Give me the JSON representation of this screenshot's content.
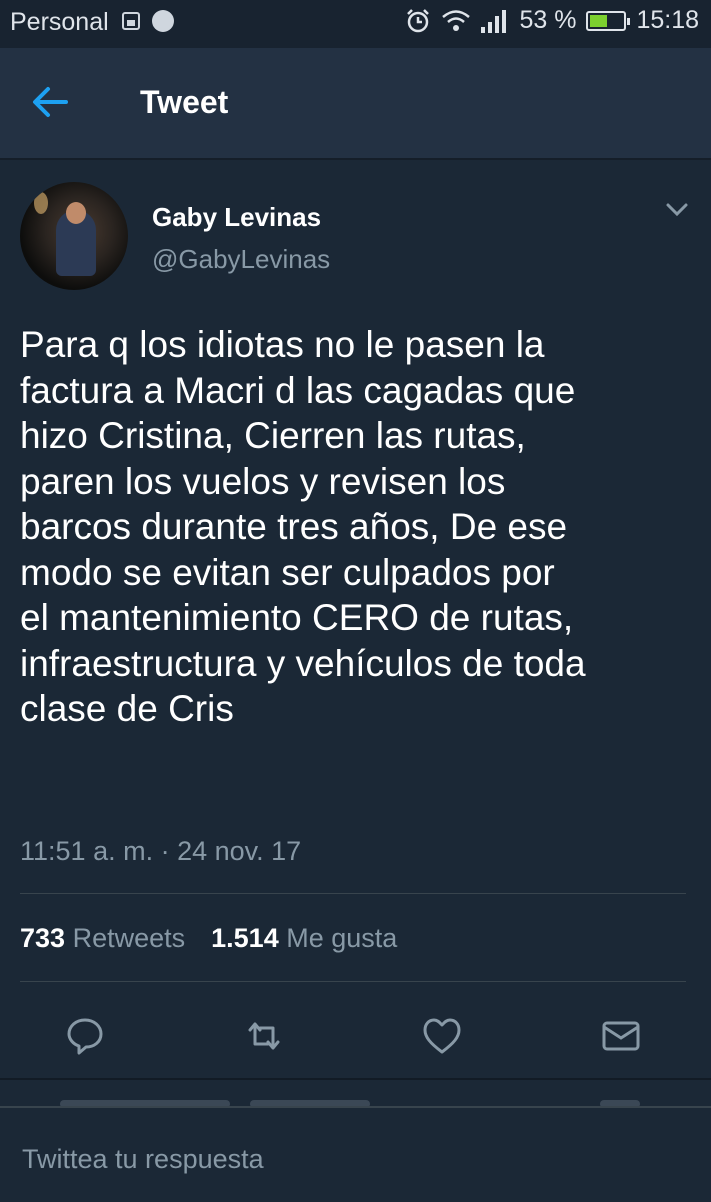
{
  "status_bar": {
    "carrier": "Personal",
    "battery_percent": "53 %",
    "battery_level": 0.53,
    "time": "15:18",
    "icons": [
      "gallery-icon",
      "globe-icon",
      "alarm-icon",
      "wifi-icon",
      "signal-icon",
      "battery-charging-icon"
    ]
  },
  "app_bar": {
    "title": "Tweet",
    "back_icon": "arrow-left-icon"
  },
  "tweet": {
    "author_name": "Gaby Levinas",
    "author_handle": "@GabyLevinas",
    "text": "Para q los idiotas no le pasen la\nfactura a Macri d las cagadas que\nhizo Cristina, Cierren las rutas,\nparen los vuelos y revisen los\nbarcos durante tres años, De ese\nmodo se evitan ser culpados por\nel  mantenimiento CERO de rutas,\ninfraestructura y vehículos de toda\nclase de Cris",
    "timestamp": "11:51 a. m. · 24 nov. 17",
    "retweets_count": "733",
    "retweets_label": "Retweets",
    "likes_count": "1.514",
    "likes_label": "Me gusta"
  },
  "actions": [
    "reply-icon",
    "retweet-icon",
    "like-icon",
    "message-icon"
  ],
  "reply_box": {
    "placeholder": "Twittea tu respuesta"
  },
  "colors": {
    "background": "#1b2836",
    "app_bar": "#233143",
    "accent": "#1da1f2",
    "secondary_text": "#8899a6",
    "divider": "#38444d"
  }
}
